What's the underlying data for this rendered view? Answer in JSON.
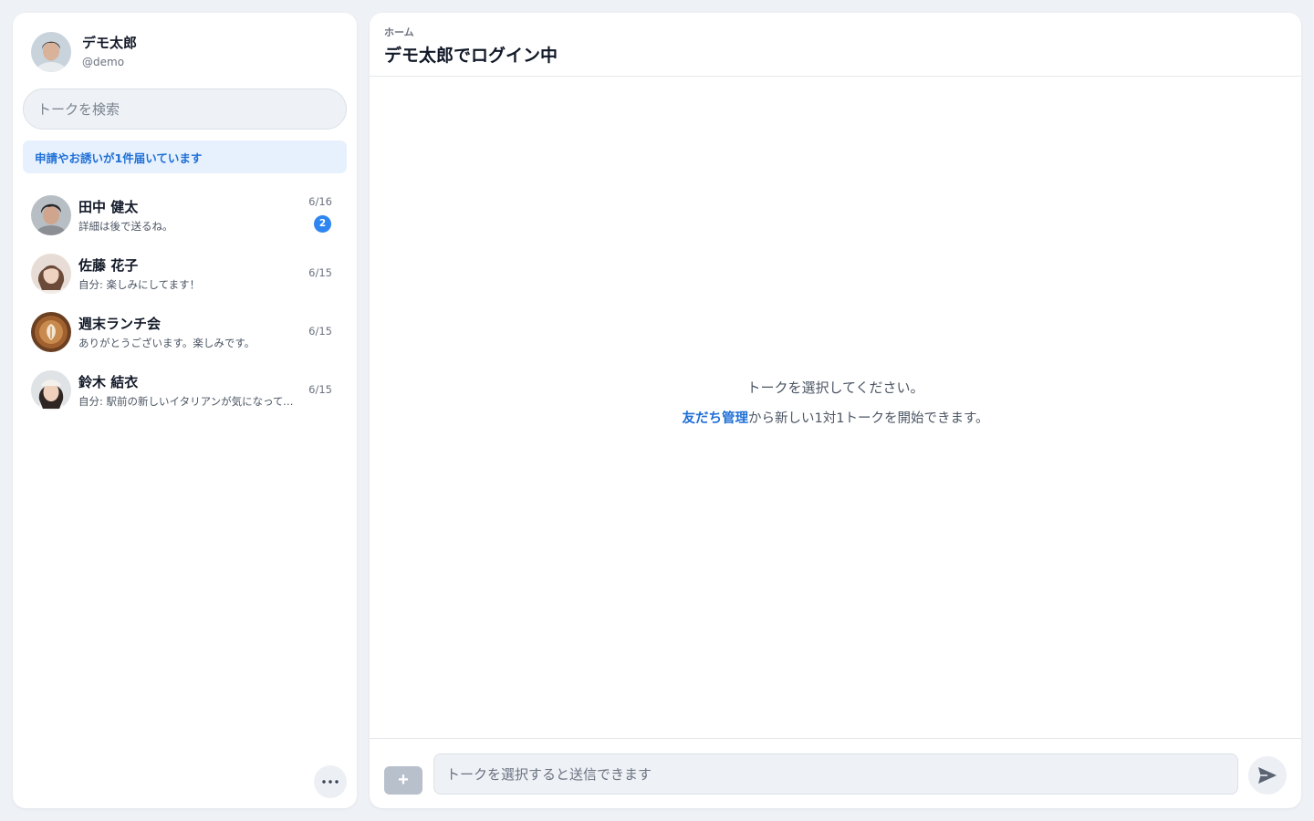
{
  "profile": {
    "name": "デモ太郎",
    "handle": "@demo"
  },
  "search": {
    "placeholder": "トークを検索"
  },
  "notice": {
    "text": "申請やお誘いが1件届いています"
  },
  "talks": [
    {
      "name": "田中 健太",
      "preview": "詳細は後で送るね。",
      "date": "6/16",
      "badge": "2"
    },
    {
      "name": "佐藤 花子",
      "preview": "自分: 楽しみにしてます！",
      "date": "6/15"
    },
    {
      "name": "週末ランチ会",
      "preview": "ありがとうございます。楽しみです。",
      "date": "6/15"
    },
    {
      "name": "鈴木 結衣",
      "preview": "自分: 駅前の新しいイタリアンが気になってます",
      "date": "6/15"
    }
  ],
  "header": {
    "breadcrumb": "ホーム",
    "title": "デモ太郎でログイン中"
  },
  "empty": {
    "title": "トークを選択してください。",
    "link": "友だち管理",
    "hint_rest": "から新しい1対1トークを開始できます。"
  },
  "composer": {
    "placeholder": "トークを選択すると送信できます",
    "attach_label": "+"
  },
  "icons": {
    "more": "more-icon",
    "send": "send-icon",
    "attach": "plus-icon"
  },
  "colors": {
    "accent": "#1f6fd6",
    "badge": "#2f86f0",
    "notice_bg": "#e6f1fd"
  }
}
